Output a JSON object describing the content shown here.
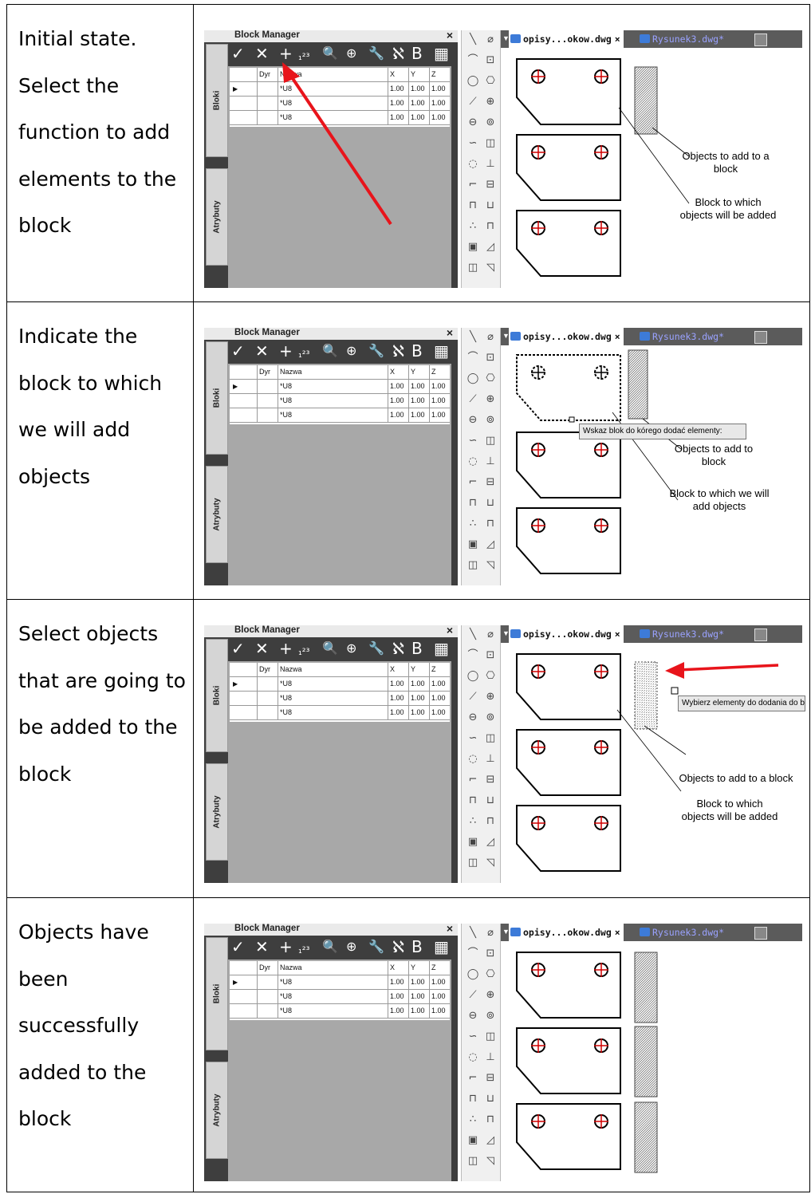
{
  "steps": [
    {
      "description": "Initial state. Select the function to add elements to the block",
      "tooltip": "",
      "label1": "Objects to add to a block",
      "label2": "Block to which objects will be added"
    },
    {
      "description": "Indicate the block to which we will add objects",
      "tooltip": "Wskaz blok do kórego dodać elementy:",
      "label1": "Objects to add to block",
      "label2": "Block to which we will add objects"
    },
    {
      "description": "Select objects that are going to be added to the block",
      "tooltip": "Wybierz elementy do dodania do blo",
      "label1": "Objects to add to a block",
      "label2": "Block to which objects will be added"
    },
    {
      "description": "Objects have been successfully added to the block",
      "tooltip": "",
      "label1": "",
      "label2": ""
    }
  ],
  "block_manager": {
    "title": "Block Manager",
    "close": "×",
    "tab_bloki": "Bloki",
    "tab_atrybuty": "Atrybuty",
    "toolbar": [
      "✓",
      "✕",
      "+",
      "₁²³",
      "🔍",
      "⊕",
      "🔧",
      "ℵ",
      "B",
      "▦"
    ],
    "columns": [
      "Dyr",
      "Nazwa",
      "X",
      "Y",
      "Z"
    ],
    "rows": [
      {
        "name": "*U8",
        "x": "1.00",
        "y": "1.00",
        "z": "1.00"
      },
      {
        "name": "*U8",
        "x": "1.00",
        "y": "1.00",
        "z": "1.00"
      },
      {
        "name": "*U8",
        "x": "1.00",
        "y": "1.00",
        "z": "1.00"
      }
    ]
  },
  "doc_tabs": {
    "active": "opisy...okow.dwg",
    "close": "×",
    "inactive": "Rysunek3.dwg*"
  },
  "colors": {
    "arrow": "#e8141b",
    "hole": "#d00000",
    "panel": "#3e3e3e"
  }
}
